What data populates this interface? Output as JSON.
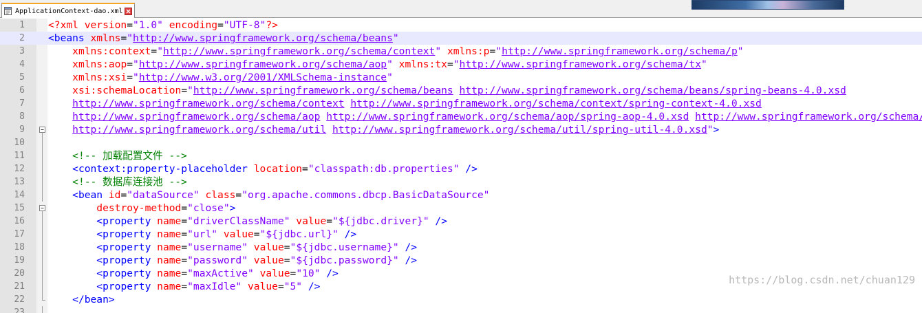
{
  "tab": {
    "filename": "ApplicationContext-dao.xml",
    "file_icon": "file-icon",
    "close_icon": "close-icon"
  },
  "colors": {
    "tag": "#0000ff",
    "attribute": "#ff0000",
    "value": "#8000ff",
    "comment": "#008000",
    "processing_instruction": "#ff0000",
    "line_number": "#808080",
    "current_line_bg": "#e8e8ff"
  },
  "editor": {
    "current_line": 2,
    "lines": [
      {
        "n": "1",
        "fold": "",
        "tokens": [
          {
            "t": "pi",
            "v": "<?xml "
          },
          {
            "t": "attr",
            "v": "version"
          },
          {
            "t": "eq",
            "v": "="
          },
          {
            "t": "val",
            "v": "\"1.0\""
          },
          {
            "t": "eq",
            "v": " "
          },
          {
            "t": "attr",
            "v": "encoding"
          },
          {
            "t": "eq",
            "v": "="
          },
          {
            "t": "val",
            "v": "\"UTF-8\""
          },
          {
            "t": "pi",
            "v": "?>"
          }
        ]
      },
      {
        "n": "2",
        "fold": "",
        "tokens": [
          {
            "t": "tag",
            "v": "<beans "
          },
          {
            "t": "attr",
            "v": "xmlns"
          },
          {
            "t": "eq",
            "v": "="
          },
          {
            "t": "val",
            "v": "\""
          },
          {
            "t": "url",
            "v": "http://www.springframework.org/schema/beans"
          },
          {
            "t": "val",
            "v": "\""
          }
        ]
      },
      {
        "n": "3",
        "fold": "",
        "tokens": [
          {
            "t": "eq",
            "v": "    "
          },
          {
            "t": "attr",
            "v": "xmlns:context"
          },
          {
            "t": "eq",
            "v": "="
          },
          {
            "t": "val",
            "v": "\""
          },
          {
            "t": "url",
            "v": "http://www.springframework.org/schema/context"
          },
          {
            "t": "val",
            "v": "\""
          },
          {
            "t": "eq",
            "v": " "
          },
          {
            "t": "attr",
            "v": "xmlns:p"
          },
          {
            "t": "eq",
            "v": "="
          },
          {
            "t": "val",
            "v": "\""
          },
          {
            "t": "url",
            "v": "http://www.springframework.org/schema/p"
          },
          {
            "t": "val",
            "v": "\""
          }
        ]
      },
      {
        "n": "4",
        "fold": "",
        "tokens": [
          {
            "t": "eq",
            "v": "    "
          },
          {
            "t": "attr",
            "v": "xmlns:aop"
          },
          {
            "t": "eq",
            "v": "="
          },
          {
            "t": "val",
            "v": "\""
          },
          {
            "t": "url",
            "v": "http://www.springframework.org/schema/aop"
          },
          {
            "t": "val",
            "v": "\""
          },
          {
            "t": "eq",
            "v": " "
          },
          {
            "t": "attr",
            "v": "xmlns:tx"
          },
          {
            "t": "eq",
            "v": "="
          },
          {
            "t": "val",
            "v": "\""
          },
          {
            "t": "url",
            "v": "http://www.springframework.org/schema/tx"
          },
          {
            "t": "val",
            "v": "\""
          }
        ]
      },
      {
        "n": "5",
        "fold": "",
        "tokens": [
          {
            "t": "eq",
            "v": "    "
          },
          {
            "t": "attr",
            "v": "xmlns:xsi"
          },
          {
            "t": "eq",
            "v": "="
          },
          {
            "t": "val",
            "v": "\""
          },
          {
            "t": "url",
            "v": "http://www.w3.org/2001/XMLSchema-instance"
          },
          {
            "t": "val",
            "v": "\""
          }
        ]
      },
      {
        "n": "6",
        "fold": "",
        "tokens": [
          {
            "t": "eq",
            "v": "    "
          },
          {
            "t": "attr",
            "v": "xsi:schemaLocation"
          },
          {
            "t": "eq",
            "v": "="
          },
          {
            "t": "val",
            "v": "\""
          },
          {
            "t": "url",
            "v": "http://www.springframework.org/schema/beans"
          },
          {
            "t": "eq",
            "v": " "
          },
          {
            "t": "url",
            "v": "http://www.springframework.org/schema/beans/spring-beans-4.0.xsd"
          }
        ]
      },
      {
        "n": "7",
        "fold": "",
        "tokens": [
          {
            "t": "eq",
            "v": "    "
          },
          {
            "t": "url",
            "v": "http://www.springframework.org/schema/context"
          },
          {
            "t": "eq",
            "v": " "
          },
          {
            "t": "url",
            "v": "http://www.springframework.org/schema/context/spring-context-4.0.xsd"
          }
        ]
      },
      {
        "n": "8",
        "fold": "",
        "tokens": [
          {
            "t": "eq",
            "v": "    "
          },
          {
            "t": "url",
            "v": "http://www.springframework.org/schema/aop"
          },
          {
            "t": "eq",
            "v": " "
          },
          {
            "t": "url",
            "v": "http://www.springframework.org/schema/aop/spring-aop-4.0.xsd"
          },
          {
            "t": "eq",
            "v": " "
          },
          {
            "t": "url",
            "v": "http://www.springframework.org/schema/tx"
          }
        ]
      },
      {
        "n": "9",
        "fold": "box",
        "tokens": [
          {
            "t": "eq",
            "v": "    "
          },
          {
            "t": "url",
            "v": "http://www.springframework.org/schema/util"
          },
          {
            "t": "eq",
            "v": " "
          },
          {
            "t": "url",
            "v": "http://www.springframework.org/schema/util/spring-util-4.0.xsd"
          },
          {
            "t": "val",
            "v": "\""
          },
          {
            "t": "tag",
            "v": ">"
          }
        ]
      },
      {
        "n": "10",
        "fold": "bar",
        "tokens": []
      },
      {
        "n": "11",
        "fold": "bar",
        "tokens": [
          {
            "t": "eq",
            "v": "    "
          },
          {
            "t": "cmt",
            "v": "<!-- 加载配置文件 -->"
          }
        ]
      },
      {
        "n": "12",
        "fold": "bar",
        "tokens": [
          {
            "t": "eq",
            "v": "    "
          },
          {
            "t": "tag",
            "v": "<context:property-placeholder "
          },
          {
            "t": "attr",
            "v": "location"
          },
          {
            "t": "eq",
            "v": "="
          },
          {
            "t": "val",
            "v": "\"classpath:db.properties\""
          },
          {
            "t": "eq",
            "v": " "
          },
          {
            "t": "tag",
            "v": "/>"
          }
        ]
      },
      {
        "n": "13",
        "fold": "bar",
        "tokens": [
          {
            "t": "eq",
            "v": "    "
          },
          {
            "t": "cmt",
            "v": "<!-- 数据库连接池 -->"
          }
        ]
      },
      {
        "n": "14",
        "fold": "bar",
        "tokens": [
          {
            "t": "eq",
            "v": "    "
          },
          {
            "t": "tag",
            "v": "<bean "
          },
          {
            "t": "attr",
            "v": "id"
          },
          {
            "t": "eq",
            "v": "="
          },
          {
            "t": "val",
            "v": "\"dataSource\""
          },
          {
            "t": "eq",
            "v": " "
          },
          {
            "t": "attr",
            "v": "class"
          },
          {
            "t": "eq",
            "v": "="
          },
          {
            "t": "val",
            "v": "\"org.apache.commons.dbcp.BasicDataSource\""
          }
        ]
      },
      {
        "n": "15",
        "fold": "box",
        "tokens": [
          {
            "t": "eq",
            "v": "        "
          },
          {
            "t": "attr",
            "v": "destroy-method"
          },
          {
            "t": "eq",
            "v": "="
          },
          {
            "t": "val",
            "v": "\"close\""
          },
          {
            "t": "tag",
            "v": ">"
          }
        ]
      },
      {
        "n": "16",
        "fold": "bar",
        "tokens": [
          {
            "t": "eq",
            "v": "        "
          },
          {
            "t": "tag",
            "v": "<property "
          },
          {
            "t": "attr",
            "v": "name"
          },
          {
            "t": "eq",
            "v": "="
          },
          {
            "t": "val",
            "v": "\"driverClassName\""
          },
          {
            "t": "eq",
            "v": " "
          },
          {
            "t": "attr",
            "v": "value"
          },
          {
            "t": "eq",
            "v": "="
          },
          {
            "t": "val",
            "v": "\"${jdbc.driver}\""
          },
          {
            "t": "eq",
            "v": " "
          },
          {
            "t": "tag",
            "v": "/>"
          }
        ]
      },
      {
        "n": "17",
        "fold": "bar",
        "tokens": [
          {
            "t": "eq",
            "v": "        "
          },
          {
            "t": "tag",
            "v": "<property "
          },
          {
            "t": "attr",
            "v": "name"
          },
          {
            "t": "eq",
            "v": "="
          },
          {
            "t": "val",
            "v": "\"url\""
          },
          {
            "t": "eq",
            "v": " "
          },
          {
            "t": "attr",
            "v": "value"
          },
          {
            "t": "eq",
            "v": "="
          },
          {
            "t": "val",
            "v": "\"${jdbc.url}\""
          },
          {
            "t": "eq",
            "v": " "
          },
          {
            "t": "tag",
            "v": "/>"
          }
        ]
      },
      {
        "n": "18",
        "fold": "bar",
        "tokens": [
          {
            "t": "eq",
            "v": "        "
          },
          {
            "t": "tag",
            "v": "<property "
          },
          {
            "t": "attr",
            "v": "name"
          },
          {
            "t": "eq",
            "v": "="
          },
          {
            "t": "val",
            "v": "\"username\""
          },
          {
            "t": "eq",
            "v": " "
          },
          {
            "t": "attr",
            "v": "value"
          },
          {
            "t": "eq",
            "v": "="
          },
          {
            "t": "val",
            "v": "\"${jdbc.username}\""
          },
          {
            "t": "eq",
            "v": " "
          },
          {
            "t": "tag",
            "v": "/>"
          }
        ]
      },
      {
        "n": "19",
        "fold": "bar",
        "tokens": [
          {
            "t": "eq",
            "v": "        "
          },
          {
            "t": "tag",
            "v": "<property "
          },
          {
            "t": "attr",
            "v": "name"
          },
          {
            "t": "eq",
            "v": "="
          },
          {
            "t": "val",
            "v": "\"password\""
          },
          {
            "t": "eq",
            "v": " "
          },
          {
            "t": "attr",
            "v": "value"
          },
          {
            "t": "eq",
            "v": "="
          },
          {
            "t": "val",
            "v": "\"${jdbc.password}\""
          },
          {
            "t": "eq",
            "v": " "
          },
          {
            "t": "tag",
            "v": "/>"
          }
        ]
      },
      {
        "n": "20",
        "fold": "bar",
        "tokens": [
          {
            "t": "eq",
            "v": "        "
          },
          {
            "t": "tag",
            "v": "<property "
          },
          {
            "t": "attr",
            "v": "name"
          },
          {
            "t": "eq",
            "v": "="
          },
          {
            "t": "val",
            "v": "\"maxActive\""
          },
          {
            "t": "eq",
            "v": " "
          },
          {
            "t": "attr",
            "v": "value"
          },
          {
            "t": "eq",
            "v": "="
          },
          {
            "t": "val",
            "v": "\"10\""
          },
          {
            "t": "eq",
            "v": " "
          },
          {
            "t": "tag",
            "v": "/>"
          }
        ]
      },
      {
        "n": "21",
        "fold": "bar",
        "tokens": [
          {
            "t": "eq",
            "v": "        "
          },
          {
            "t": "tag",
            "v": "<property "
          },
          {
            "t": "attr",
            "v": "name"
          },
          {
            "t": "eq",
            "v": "="
          },
          {
            "t": "val",
            "v": "\"maxIdle\""
          },
          {
            "t": "eq",
            "v": " "
          },
          {
            "t": "attr",
            "v": "value"
          },
          {
            "t": "eq",
            "v": "="
          },
          {
            "t": "val",
            "v": "\"5\""
          },
          {
            "t": "eq",
            "v": " "
          },
          {
            "t": "tag",
            "v": "/>"
          }
        ]
      },
      {
        "n": "22",
        "fold": "end",
        "tokens": [
          {
            "t": "eq",
            "v": "    "
          },
          {
            "t": "tag",
            "v": "</bean>"
          }
        ]
      },
      {
        "n": "23",
        "fold": "bar",
        "tokens": []
      }
    ]
  },
  "watermark": "https://blog.csdn.net/chuan129"
}
